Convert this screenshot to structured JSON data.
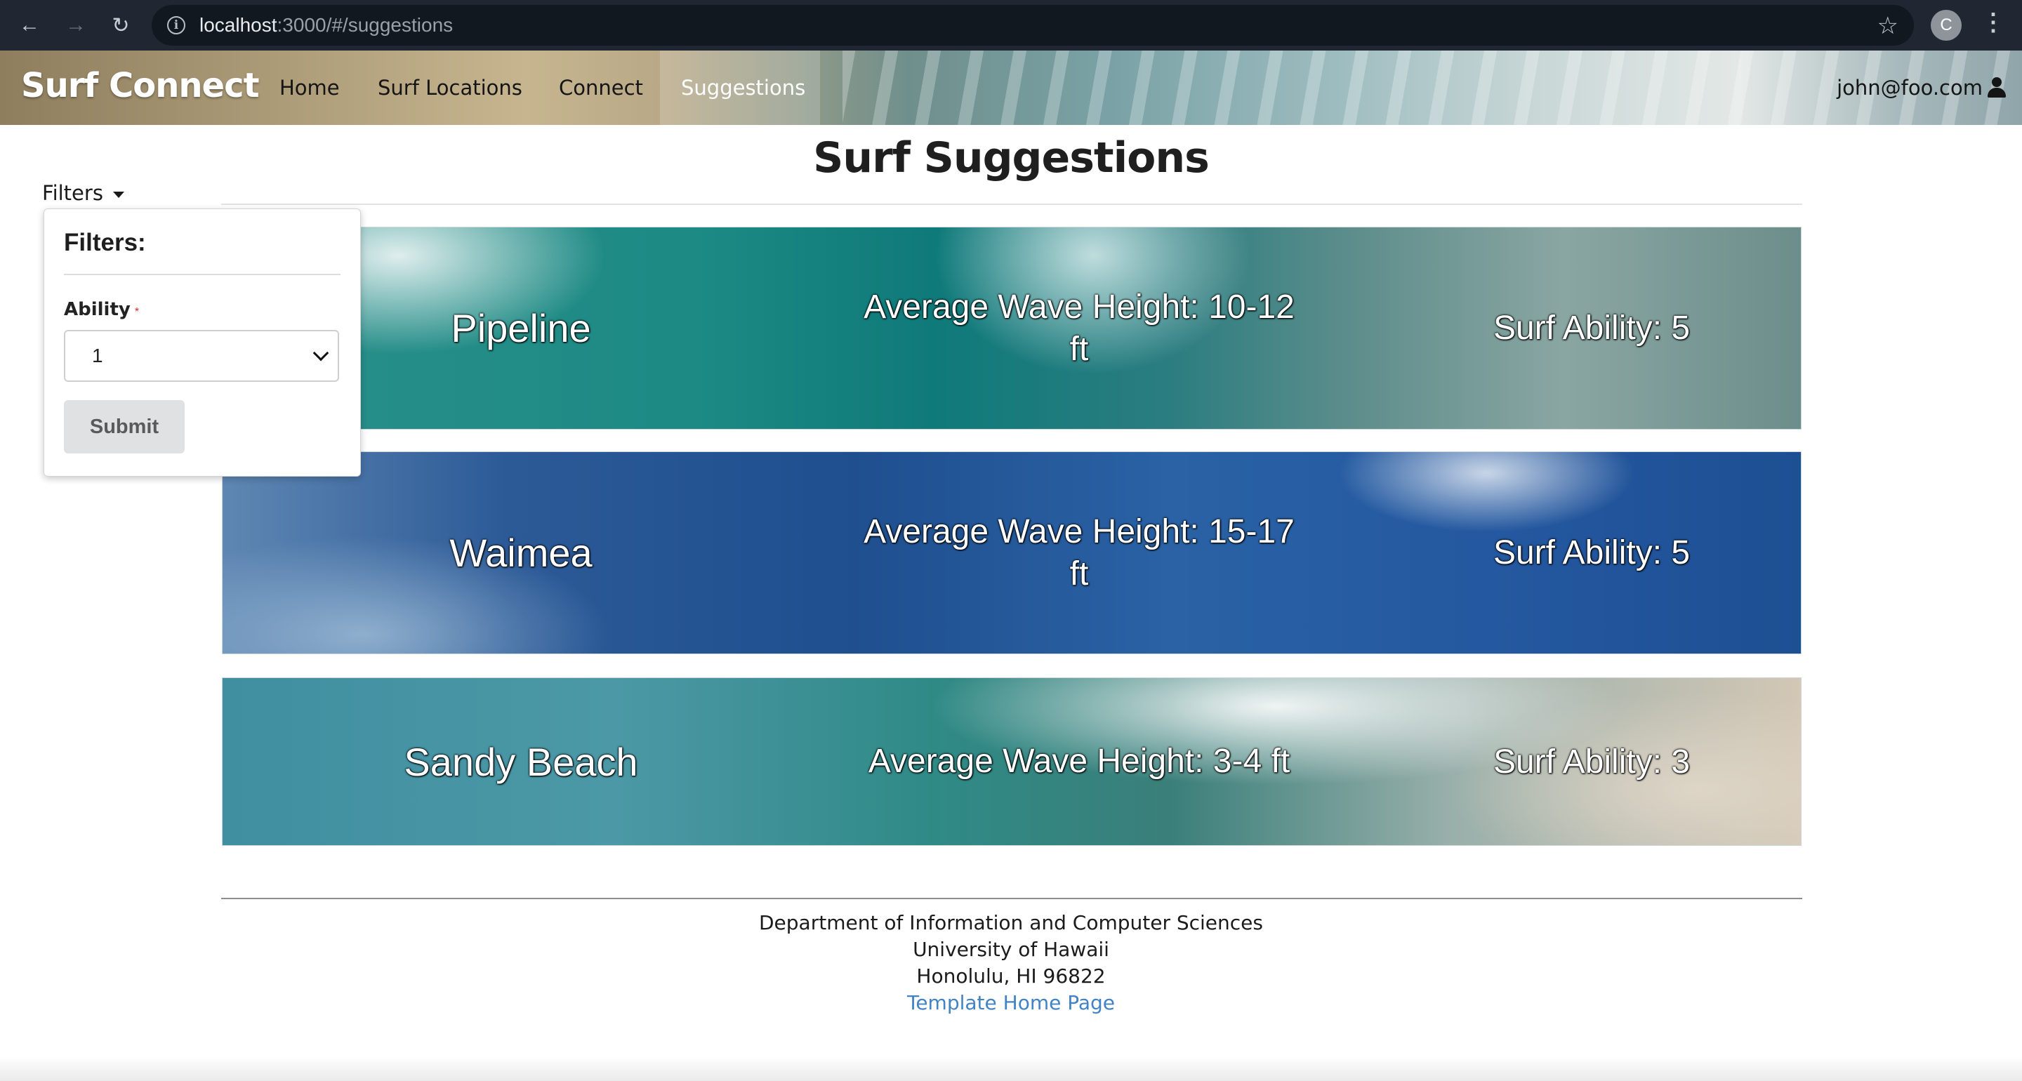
{
  "browser": {
    "url_host": "localhost",
    "url_path": ":3000/#/suggestions",
    "profile_initial": "C"
  },
  "navbar": {
    "brand": "Surf Connect",
    "items": [
      {
        "label": "Home"
      },
      {
        "label": "Surf Locations"
      },
      {
        "label": "Connect"
      },
      {
        "label": "Suggestions"
      }
    ],
    "active_item": "Suggestions",
    "user": "john@foo.com"
  },
  "page": {
    "title": "Surf Suggestions"
  },
  "filters": {
    "toggle_label": "Filters",
    "panel_title": "Filters:",
    "ability_label": "Ability",
    "required_mark": "*",
    "ability_value": "1",
    "submit_label": "Submit"
  },
  "suggestions": [
    {
      "name": "Pipeline",
      "wave": "Average Wave Height: 10-12 ft",
      "ability": "Surf Ability: 5"
    },
    {
      "name": "Waimea",
      "wave": "Average Wave Height: 15-17 ft",
      "ability": "Surf Ability: 5"
    },
    {
      "name": "Sandy Beach",
      "wave": "Average Wave Height: 3-4 ft",
      "ability": "Surf Ability: 3"
    }
  ],
  "footer": {
    "line1": "Department of Information and Computer Sciences",
    "line2": "University of Hawaii",
    "line3": "Honolulu, HI 96822",
    "link": "Template Home Page"
  },
  "colors": {
    "link": "#4183c4",
    "required": "#db2828",
    "chrome_bg": "#202733"
  }
}
